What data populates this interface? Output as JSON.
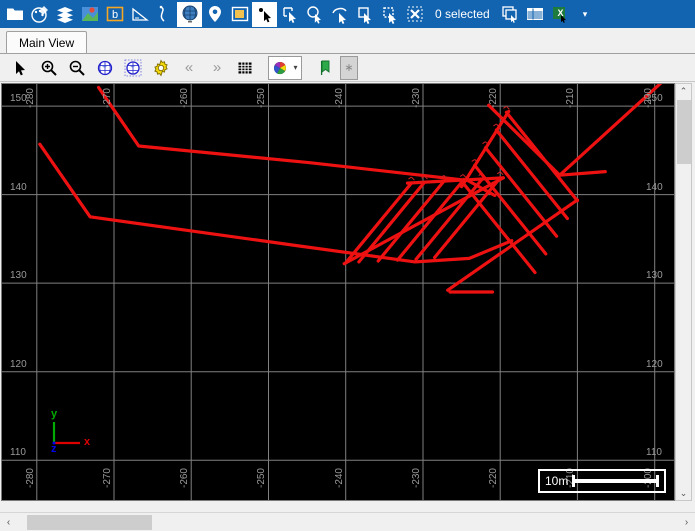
{
  "ribbon": {
    "buttons": [
      {
        "name": "open-folder-icon",
        "glyph": "folder"
      },
      {
        "name": "palette-icon",
        "glyph": "palette"
      },
      {
        "name": "layers-icon",
        "glyph": "layers"
      },
      {
        "name": "map-icon",
        "glyph": "map"
      },
      {
        "name": "borehole-icon",
        "glyph": "borehole"
      },
      {
        "name": "section-icon",
        "glyph": "section"
      },
      {
        "name": "curve-icon",
        "glyph": "curve"
      },
      {
        "name": "globe-icon",
        "glyph": "globe"
      },
      {
        "name": "pin-icon",
        "glyph": "pin"
      },
      {
        "name": "window-icon",
        "glyph": "window"
      },
      {
        "name": "select-point-icon",
        "glyph": "selectpoint"
      },
      {
        "name": "select-rect-icon",
        "glyph": "selrect"
      },
      {
        "name": "select-circle-icon",
        "glyph": "selcircle"
      },
      {
        "name": "select-lasso-icon",
        "glyph": "sellasso"
      },
      {
        "name": "select-box-icon",
        "glyph": "selbox"
      },
      {
        "name": "select-polygon-icon",
        "glyph": "selpoly"
      },
      {
        "name": "clear-selection-icon",
        "glyph": "clearsel"
      }
    ],
    "selection_label": "0 selected",
    "after_buttons": [
      {
        "name": "copy-selection-icon",
        "glyph": "copysel"
      },
      {
        "name": "table-view-icon",
        "glyph": "table"
      },
      {
        "name": "export-excel-icon",
        "glyph": "excel"
      }
    ],
    "overflow_caret": "▾"
  },
  "tabs": [
    {
      "name": "tab-main-view",
      "label": "Main View",
      "active": true
    }
  ],
  "view_toolbar": {
    "buttons": [
      {
        "name": "pointer-tool-icon",
        "glyph": "pointer"
      },
      {
        "name": "zoom-in-icon",
        "glyph": "zoomin"
      },
      {
        "name": "zoom-out-icon",
        "glyph": "zoomout"
      },
      {
        "name": "globe-view-icon",
        "glyph": "globe2"
      },
      {
        "name": "globe-fit-icon",
        "glyph": "globefit"
      },
      {
        "name": "settings-gear-icon",
        "glyph": "gear"
      },
      {
        "name": "step-back-icon",
        "glyph": "«"
      },
      {
        "name": "step-forward-icon",
        "glyph": "»"
      },
      {
        "name": "grid-toggle-icon",
        "glyph": "grid"
      },
      {
        "name": "color-palette-dropdown",
        "glyph": "palettedrop"
      },
      {
        "name": "bookmark-icon",
        "glyph": "bookmark"
      },
      {
        "name": "star-button-disabled",
        "glyph": "∗"
      }
    ]
  },
  "chart_data": {
    "type": "line",
    "title": "",
    "xlabel": "",
    "ylabel": "",
    "xlim": [
      -284.5,
      -197.5
    ],
    "ylim": [
      105.5,
      152.5
    ],
    "grid": true,
    "background": "#000000",
    "grid_color": "#808080",
    "tick_color": "#9a9a9a",
    "series_color": "#ee1111",
    "x_ticks_top": [
      -280,
      -270,
      -260,
      -250,
      -240,
      -230,
      -220,
      -210,
      -200
    ],
    "x_ticks_bottom": [
      -280,
      -270,
      -260,
      -250,
      -240,
      -230,
      -220,
      -210,
      -200
    ],
    "y_ticks_left": [
      150,
      140,
      130,
      120,
      110
    ],
    "y_ticks_right": [
      150,
      140,
      130,
      120,
      110
    ],
    "series": [
      {
        "name": "upper-ground-surface",
        "points": [
          [
            -272.0,
            152.1
          ],
          [
            -266.8,
            145.5
          ],
          [
            -244.5,
            143.6
          ],
          [
            -224.2,
            141.6
          ],
          [
            -220.7,
            139.9
          ]
        ]
      },
      {
        "name": "lower-ground-surface",
        "points": [
          [
            -279.6,
            145.7
          ],
          [
            -273.1,
            137.5
          ],
          [
            -246.0,
            134.2
          ],
          [
            -231.0,
            132.4
          ],
          [
            -224.0,
            132.8
          ],
          [
            -218.5,
            134.8
          ]
        ]
      },
      {
        "name": "excavation-face-upper",
        "points": [
          [
            -221.5,
            150.1
          ],
          [
            -212.3,
            142.2
          ],
          [
            -199.2,
            152.6
          ]
        ]
      },
      {
        "name": "wall-line-right",
        "points": [
          [
            -212.3,
            142.2
          ],
          [
            -206.4,
            142.6
          ]
        ]
      },
      {
        "name": "excavation-base",
        "points": [
          [
            -226.5,
            129.0
          ],
          [
            -221.0,
            129.0
          ]
        ]
      }
    ],
    "anchor_rows": [
      {
        "name": "nail-row-1",
        "head": [
          -231.5,
          141.3
        ],
        "tail": [
          -239.9,
          132.4
        ]
      },
      {
        "name": "nail-row-2",
        "head": [
          -229.8,
          141.4
        ],
        "tail": [
          -238.3,
          132.4
        ]
      },
      {
        "name": "nail-row-3",
        "head": [
          -227.3,
          141.5
        ],
        "tail": [
          -235.8,
          132.5
        ]
      },
      {
        "name": "nail-row-4",
        "head": [
          -224.8,
          141.6
        ],
        "tail": [
          -233.3,
          132.6
        ]
      },
      {
        "name": "nail-row-5",
        "head": [
          -222.4,
          141.7
        ],
        "tail": [
          -230.9,
          132.7
        ]
      },
      {
        "name": "nail-row-6",
        "head": [
          -220.0,
          141.9
        ],
        "tail": [
          -228.5,
          132.9
        ]
      }
    ],
    "anchor_rows_2": [
      {
        "name": "anchor-row-1",
        "head": [
          -219.2,
          149.3
        ],
        "tail": [
          -210.0,
          139.3
        ]
      },
      {
        "name": "anchor-row-2",
        "head": [
          -220.5,
          147.3
        ],
        "tail": [
          -211.3,
          137.3
        ]
      },
      {
        "name": "anchor-row-3",
        "head": [
          -221.9,
          145.3
        ],
        "tail": [
          -212.7,
          135.3
        ]
      },
      {
        "name": "anchor-row-4",
        "head": [
          -223.3,
          143.3
        ],
        "tail": [
          -214.1,
          133.3
        ]
      },
      {
        "name": "anchor-row-5",
        "head": [
          -224.7,
          141.2
        ],
        "tail": [
          -215.5,
          131.2
        ]
      }
    ],
    "annotation_color": "#cc2222"
  },
  "scale_bar": {
    "label": "10m",
    "name": "scale-bar"
  },
  "axis_triad": {
    "x_label": "x",
    "y_label": "y",
    "z_label": "z",
    "x_color": "#dd0000",
    "y_color": "#00aa00",
    "z_color": "#0000ee"
  },
  "scrollbars": {
    "v_up": "⌃",
    "v_down": "⌄",
    "h_left": "‹",
    "h_right": "›"
  }
}
